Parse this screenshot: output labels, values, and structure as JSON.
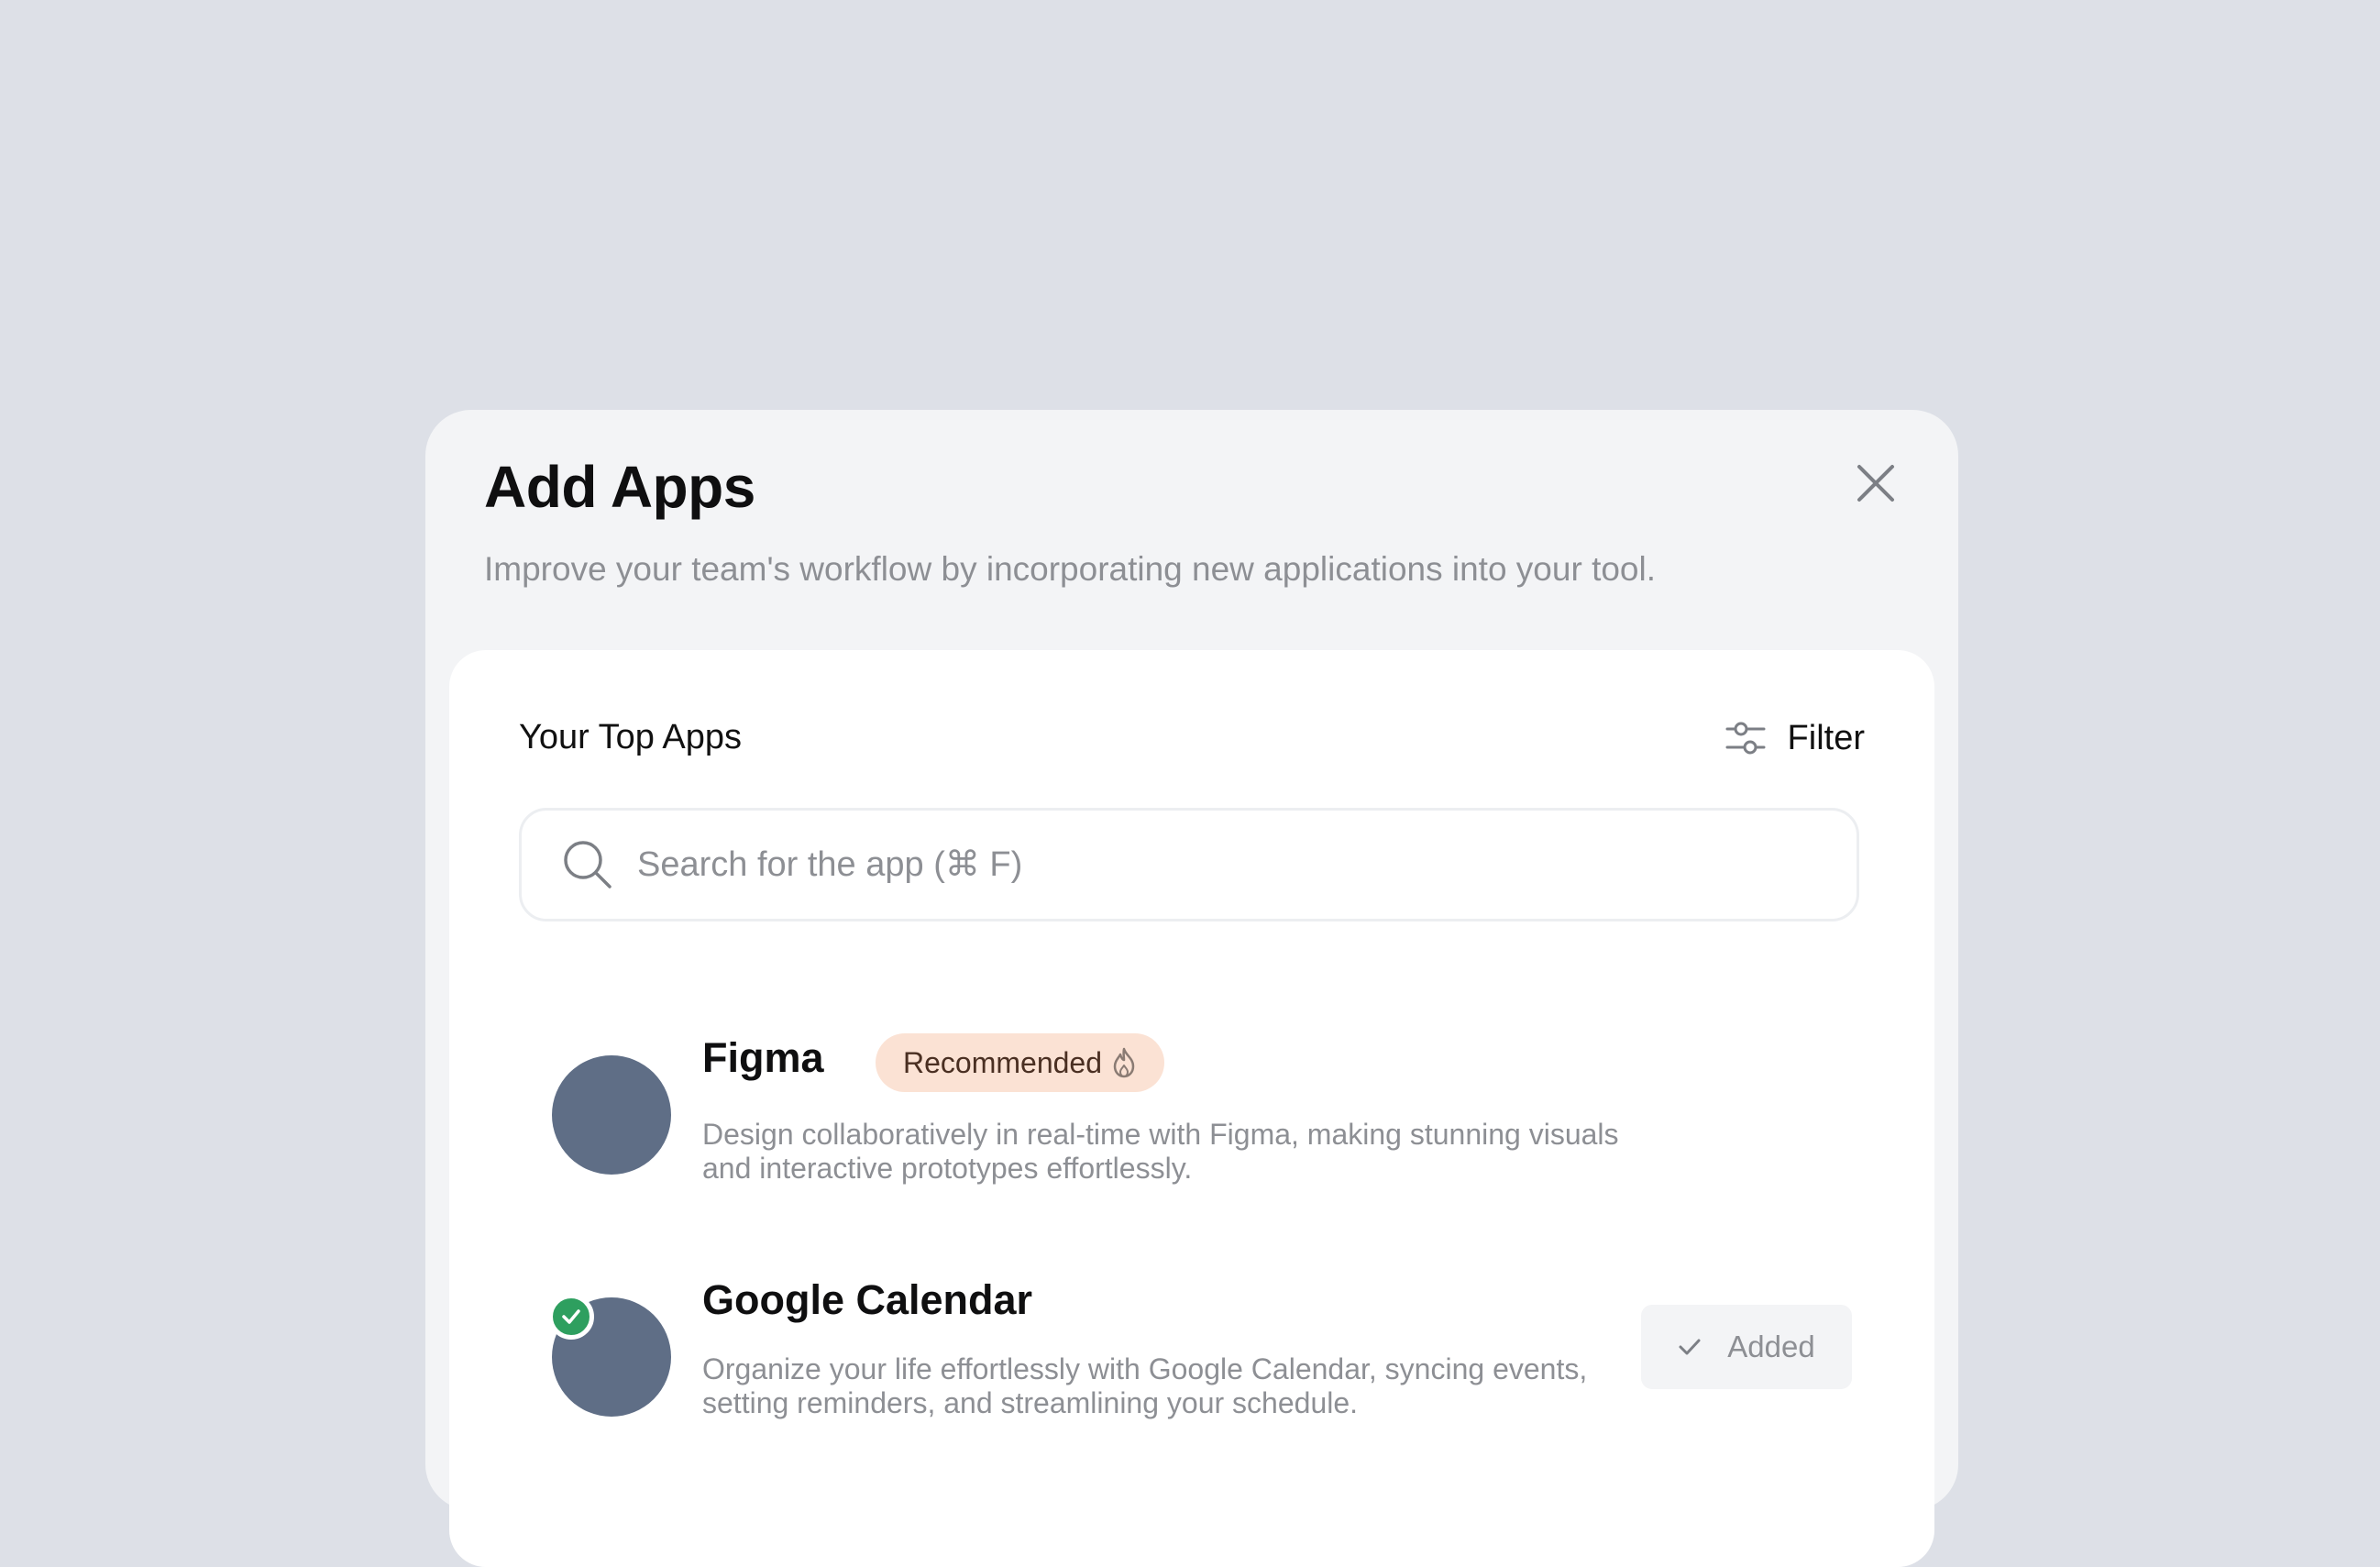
{
  "modal": {
    "title": "Add Apps",
    "subtitle": "Improve your team's workflow by incorporating new applications into your tool.",
    "close_icon": "close-icon"
  },
  "card": {
    "title": "Your Top Apps",
    "filter_label": "Filter",
    "filter_icon": "sliders-icon"
  },
  "search": {
    "placeholder": "Search for the app (⌘ F)",
    "value": "",
    "icon": "search-icon"
  },
  "apps": [
    {
      "name": "Figma",
      "tag": "Recommended",
      "tag_icon": "fire-icon",
      "description": "Design collaboratively in real-time with Figma, making stunning visuals and interactive prototypes effortlessly.",
      "added": false
    },
    {
      "name": "Google Calendar",
      "description": "Organize your life effortlessly with Google Calendar, syncing events, setting reminders, and streamlining your schedule.",
      "added": true,
      "action_label": "Added",
      "action_icon": "check-icon"
    }
  ],
  "colors": {
    "page_background": "#dde0e7",
    "modal_background": "#f3f4f6",
    "card_background": "#ffffff",
    "avatar": "#5f6e86",
    "tag_background": "#fbe2d4",
    "added_badge": "#2e9f5f",
    "muted_text": "#8d8f94"
  }
}
